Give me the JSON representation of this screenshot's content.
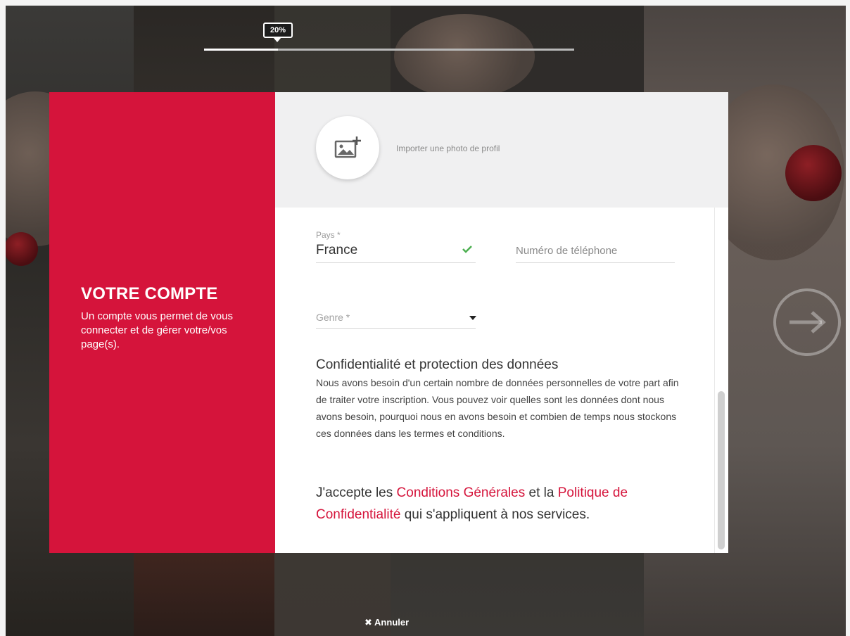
{
  "progress": {
    "percent_label": "20%",
    "value": 0.2
  },
  "sidebar": {
    "title": "VOTRE COMPTE",
    "description": "Un compte vous permet de vous connecter et de gérer votre/vos page(s)."
  },
  "photo": {
    "label": "Importer une photo de profil",
    "icon": "add-image-icon"
  },
  "form": {
    "pays": {
      "label": "Pays *",
      "value": "France",
      "status_icon": "check-icon",
      "status_color": "#4caf50"
    },
    "phone": {
      "placeholder": "Numéro de téléphone"
    },
    "genre": {
      "placeholder": "Genre *",
      "icon": "caret-down-icon"
    }
  },
  "privacy": {
    "title": "Confidentialité et protection des données",
    "text": "Nous avons besoin d'un certain nombre de données personnelles de votre part afin de traiter votre inscription. Vous pouvez voir quelles sont les données dont nous avons besoin, pourquoi nous en avons besoin et combien de temps nous stockons ces données dans les termes et conditions."
  },
  "accept": {
    "prefix": "J'accepte les ",
    "link1": "Conditions Générales",
    "middle": " et la ",
    "link2": "Politique de Confidentialité",
    "suffix": " qui s'appliquent à nos services."
  },
  "navigation": {
    "next_icon": "arrow-right-circle-icon"
  },
  "footer": {
    "cancel_label": "Annuler",
    "cancel_icon": "close-icon"
  },
  "colors": {
    "accent": "#d5143b",
    "check": "#4caf50"
  }
}
